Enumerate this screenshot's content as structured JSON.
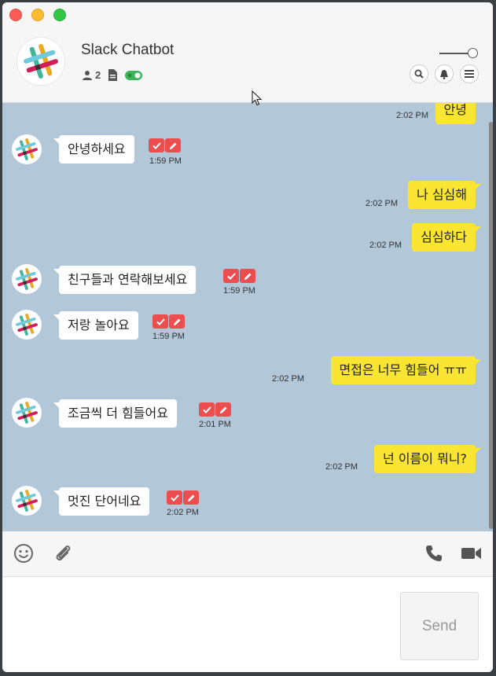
{
  "header": {
    "title": "Slack Chatbot",
    "member_count": "2"
  },
  "messages": [
    {
      "from": "me",
      "text": "안녕",
      "time": "2:02 PM"
    },
    {
      "from": "bot",
      "text": "안녕하세요",
      "time": "1:59 PM"
    },
    {
      "from": "me",
      "text": "나 심심해",
      "time": "2:02 PM"
    },
    {
      "from": "me",
      "text": "심심하다",
      "time": "2:02 PM"
    },
    {
      "from": "bot",
      "text": "친구들과 연락해보세요",
      "time": "1:59 PM"
    },
    {
      "from": "bot",
      "text": "저랑 놀아요",
      "time": "1:59 PM"
    },
    {
      "from": "me",
      "text": "면접은 너무 힘들어 ㅠㅠ",
      "time": "2:02 PM"
    },
    {
      "from": "bot",
      "text": "조금씩 더 힘들어요",
      "time": "2:01 PM"
    },
    {
      "from": "me",
      "text": "넌 이름이 뭐니?",
      "time": "2:02 PM"
    },
    {
      "from": "bot",
      "text": "멋진 단어네요",
      "time": "2:02 PM"
    }
  ],
  "composer": {
    "input_value": "",
    "send_label": "Send"
  },
  "colors": {
    "chat_background": "#b2c7d8",
    "my_bubble": "#f9e532",
    "bot_bubble": "#ffffff",
    "action_button": "#ec4e50",
    "status_toggle": "#3cb65a"
  },
  "icons": [
    "members-icon",
    "file-icon",
    "toggle-icon",
    "search-icon",
    "bell-icon",
    "menu-icon",
    "emoji-icon",
    "attach-icon",
    "phone-icon",
    "video-icon",
    "check-icon",
    "edit-icon"
  ]
}
